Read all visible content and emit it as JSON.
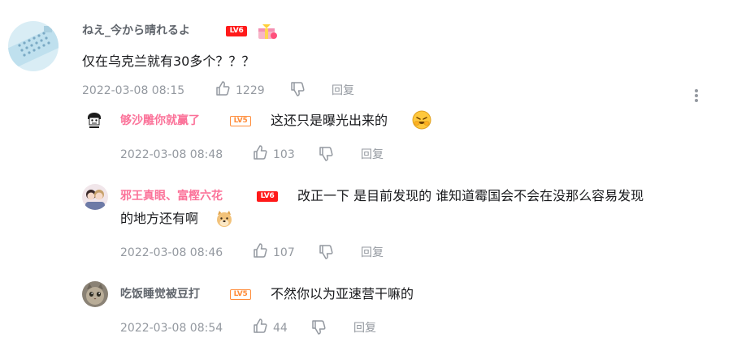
{
  "main_comment": {
    "username": "ねえ_今から晴れるよ",
    "level": "LV6",
    "text": "仅在乌克兰就有30多个？？？",
    "time": "2022-03-08 08:15",
    "likes": "1229",
    "reply_label": "回复"
  },
  "replies": [
    {
      "username": "够沙雕你就赢了",
      "level": "LV5",
      "text": "这还只是曝光出来的",
      "emoji": "doge-laugh-emoji",
      "time": "2022-03-08 08:48",
      "likes": "103",
      "reply_label": "回复"
    },
    {
      "username": "邪王真眼、富樫六花",
      "level": "LV6",
      "text_line1": "改正一下 是目前发现的 谁知道霉国会不会在没那么容易发现",
      "text_line2": "的地方还有啊",
      "emoji": "doge-emoji",
      "time": "2022-03-08 08:46",
      "likes": "107",
      "reply_label": "回复"
    },
    {
      "username": "吃饭睡觉被豆打",
      "level": "LV5",
      "text": "不然你以为亚速营干嘛的",
      "time": "2022-03-08 08:54",
      "likes": "44",
      "reply_label": "回复"
    }
  ],
  "colors": {
    "pink_username": "#fb7299",
    "gray_username": "#61666d",
    "meta_gray": "#9499a0",
    "lv6_red": "#ff1a1a",
    "lv5_orange": "#ff8c3a"
  }
}
